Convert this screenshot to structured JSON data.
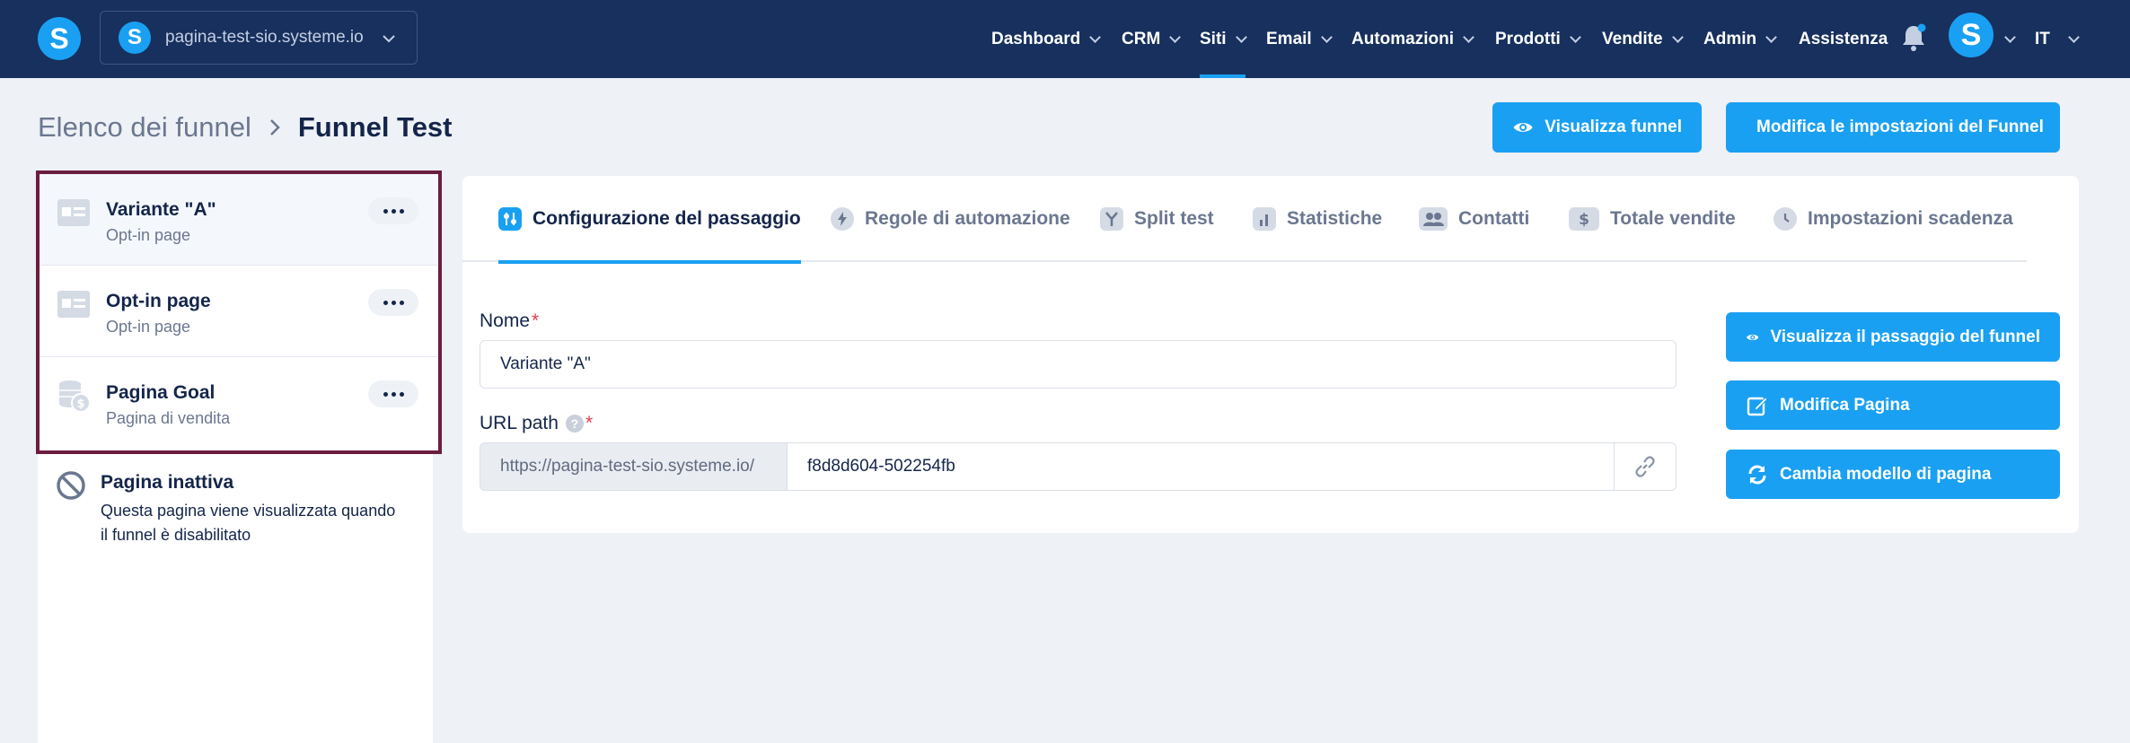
{
  "brand": {
    "logo_letter": "S",
    "accent": "#1aa0f2",
    "navbar_bg": "#17305e"
  },
  "site_selector": {
    "letter": "S",
    "name": "pagina-test-sio.systeme.io"
  },
  "nav": {
    "items": [
      {
        "label": "Dashboard"
      },
      {
        "label": "CRM"
      },
      {
        "label": "Siti"
      },
      {
        "label": "Email"
      },
      {
        "label": "Automazioni"
      },
      {
        "label": "Prodotti"
      },
      {
        "label": "Vendite"
      },
      {
        "label": "Admin"
      },
      {
        "label": "Assistenza"
      }
    ],
    "active": "Siti",
    "avatar_letter": "S",
    "language": "IT"
  },
  "breadcrumb": {
    "parent": "Elenco dei funnel",
    "current": "Funnel Test"
  },
  "header_actions": {
    "view_funnel": "Visualizza funnel",
    "edit_settings": "Modifica le impostazioni del Funnel"
  },
  "steps": [
    {
      "title": "Variante \"A\"",
      "subtitle": "Opt-in page",
      "icon": "page-icon",
      "selected": true
    },
    {
      "title": "Opt-in page",
      "subtitle": "Opt-in page",
      "icon": "page-icon",
      "selected": false
    },
    {
      "title": "Pagina Goal",
      "subtitle": "Pagina di vendita",
      "icon": "coins-icon",
      "selected": false
    }
  ],
  "inactive_page": {
    "title": "Pagina inattiva",
    "description": "Questa pagina viene visualizzata quando il funnel è disabilitato"
  },
  "tabs": [
    {
      "label": "Configurazione del passaggio",
      "icon": "sliders-icon"
    },
    {
      "label": "Regole di automazione",
      "icon": "bolt-icon"
    },
    {
      "label": "Split test",
      "icon": "split-icon"
    },
    {
      "label": "Statistiche",
      "icon": "chart-icon"
    },
    {
      "label": "Contatti",
      "icon": "users-icon"
    },
    {
      "label": "Totale vendite",
      "icon": "dollar-icon"
    },
    {
      "label": "Impostazioni scadenza",
      "icon": "clock-icon"
    }
  ],
  "form": {
    "name_label": "Nome",
    "name_value": "Variante \"A\"",
    "url_label": "URL path",
    "url_prefix": "https://pagina-test-sio.systeme.io/",
    "url_value": "f8d8d604-502254fb"
  },
  "side_actions": {
    "view_step": "Visualizza il passaggio del funnel",
    "edit_page": "Modifica Pagina",
    "change_template": "Cambia modello di pagina"
  }
}
